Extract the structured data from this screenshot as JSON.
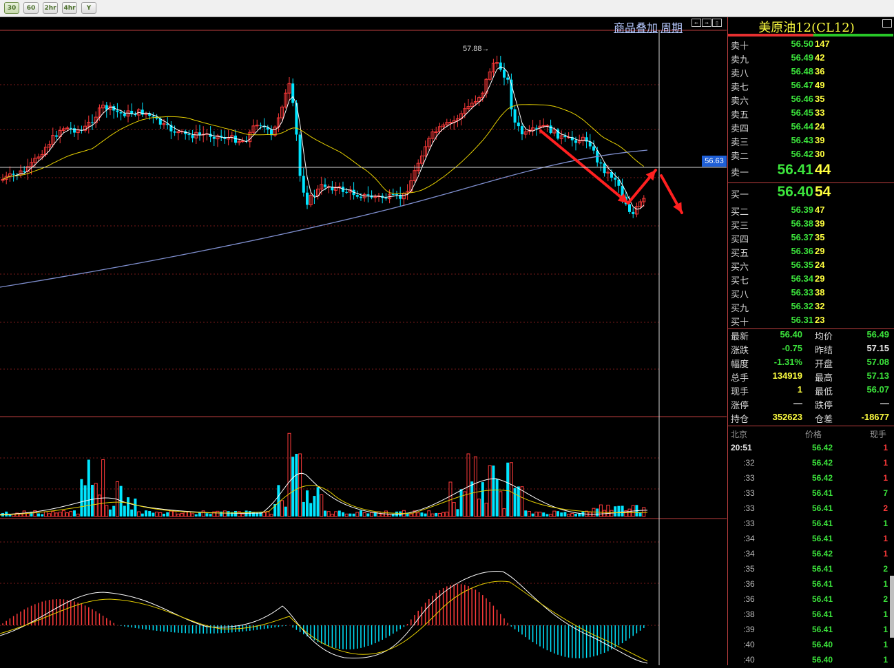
{
  "period_buttons": [
    "30",
    "60",
    "2hr",
    "4hr",
    "Y"
  ],
  "active_period": "30",
  "toolbar": {
    "overlay_label": "商品叠加",
    "cycle_label": "周期"
  },
  "chart": {
    "current_price_tag": "56.63",
    "peak_label": "57.88→",
    "colors": {
      "up": "#ff3a3a",
      "down": "#00e5ff",
      "ma_white": "#ffffff",
      "ma_yellow": "#e6d000",
      "ma_slate": "#7f8fcf",
      "grid": "#7a1a1a",
      "arrow": "#ff2020"
    }
  },
  "quote": {
    "title": "美原油12(CL12)",
    "asks": [
      {
        "label": "卖十",
        "price": "56.50",
        "vol": "147"
      },
      {
        "label": "卖九",
        "price": "56.49",
        "vol": "42"
      },
      {
        "label": "卖八",
        "price": "56.48",
        "vol": "36"
      },
      {
        "label": "卖七",
        "price": "56.47",
        "vol": "49"
      },
      {
        "label": "卖六",
        "price": "56.46",
        "vol": "35"
      },
      {
        "label": "卖五",
        "price": "56.45",
        "vol": "33"
      },
      {
        "label": "卖四",
        "price": "56.44",
        "vol": "24"
      },
      {
        "label": "卖三",
        "price": "56.43",
        "vol": "39"
      },
      {
        "label": "卖二",
        "price": "56.42",
        "vol": "30"
      },
      {
        "label": "卖一",
        "price": "56.41",
        "vol": "44"
      }
    ],
    "bids": [
      {
        "label": "买一",
        "price": "56.40",
        "vol": "54"
      },
      {
        "label": "买二",
        "price": "56.39",
        "vol": "47"
      },
      {
        "label": "买三",
        "price": "56.38",
        "vol": "39"
      },
      {
        "label": "买四",
        "price": "56.37",
        "vol": "35"
      },
      {
        "label": "买五",
        "price": "56.36",
        "vol": "29"
      },
      {
        "label": "买六",
        "price": "56.35",
        "vol": "24"
      },
      {
        "label": "买七",
        "price": "56.34",
        "vol": "29"
      },
      {
        "label": "买八",
        "price": "56.33",
        "vol": "38"
      },
      {
        "label": "买九",
        "price": "56.32",
        "vol": "32"
      },
      {
        "label": "买十",
        "price": "56.31",
        "vol": "23"
      }
    ],
    "stats": [
      {
        "l1": "最新",
        "v1": "56.40",
        "c1": "#3ce53c",
        "l2": "均价",
        "v2": "56.49",
        "c2": "#3ce53c"
      },
      {
        "l1": "涨跌",
        "v1": "-0.75",
        "c1": "#3ce53c",
        "l2": "昨结",
        "v2": "57.15",
        "c2": "#e8e8e8"
      },
      {
        "l1": "幅度",
        "v1": "-1.31%",
        "c1": "#3ce53c",
        "l2": "开盘",
        "v2": "57.08",
        "c2": "#3ce53c"
      },
      {
        "l1": "总手",
        "v1": "134919",
        "c1": "#ffff40",
        "l2": "最高",
        "v2": "57.13",
        "c2": "#3ce53c"
      },
      {
        "l1": "现手",
        "v1": "1",
        "c1": "#ffff40",
        "l2": "最低",
        "v2": "56.07",
        "c2": "#3ce53c"
      },
      {
        "l1": "涨停",
        "v1": "—",
        "c1": "#e8e8e8",
        "l2": "跌停",
        "v2": "—",
        "c2": "#e8e8e8"
      },
      {
        "l1": "持仓",
        "v1": "352623",
        "c1": "#ffff40",
        "l2": "仓差",
        "v2": "-18677",
        "c2": "#ffff40"
      }
    ],
    "ticks_header": {
      "time": "北京",
      "price": "价格",
      "vol": "现手"
    },
    "ticks": [
      {
        "time": "20:51",
        "price": "56.42",
        "vol": "1",
        "vc": "#ff3a3a"
      },
      {
        "time": ":32",
        "price": "56.42",
        "vol": "1",
        "vc": "#ff3a3a"
      },
      {
        "time": ":33",
        "price": "56.42",
        "vol": "1",
        "vc": "#ff3a3a"
      },
      {
        "time": ":33",
        "price": "56.41",
        "vol": "7",
        "vc": "#3ce53c"
      },
      {
        "time": ":33",
        "price": "56.41",
        "vol": "2",
        "vc": "#ff3a3a"
      },
      {
        "time": ":33",
        "price": "56.41",
        "vol": "1",
        "vc": "#3ce53c"
      },
      {
        "time": ":34",
        "price": "56.41",
        "vol": "1",
        "vc": "#ff3a3a"
      },
      {
        "time": ":34",
        "price": "56.42",
        "vol": "1",
        "vc": "#ff3a3a"
      },
      {
        "time": ":35",
        "price": "56.41",
        "vol": "2",
        "vc": "#3ce53c"
      },
      {
        "time": ":36",
        "price": "56.41",
        "vol": "1",
        "vc": "#3ce53c"
      },
      {
        "time": ":36",
        "price": "56.41",
        "vol": "2",
        "vc": "#3ce53c"
      },
      {
        "time": ":38",
        "price": "56.41",
        "vol": "1",
        "vc": "#3ce53c"
      },
      {
        "time": ":39",
        "price": "56.41",
        "vol": "1",
        "vc": "#3ce53c"
      },
      {
        "time": ":40",
        "price": "56.40",
        "vol": "1",
        "vc": "#3ce53c"
      },
      {
        "time": ":40",
        "price": "56.40",
        "vol": "1",
        "vc": "#3ce53c"
      }
    ]
  }
}
